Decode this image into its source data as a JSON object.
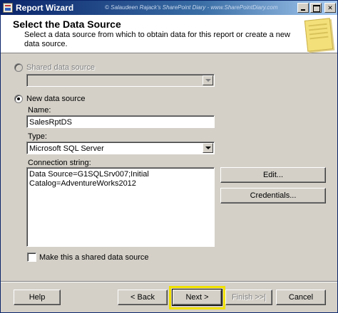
{
  "window": {
    "title": "Report Wizard",
    "watermark": "© Salaudeen Rajack's SharePoint Diary - www.SharePointDiary.com"
  },
  "header": {
    "title": "Select the Data Source",
    "subtitle": "Select a data source from which to obtain data for this report or create a new data source."
  },
  "shared_source": {
    "label": "Shared data source",
    "selected": false,
    "enabled": false,
    "dropdown_value": ""
  },
  "new_source": {
    "label": "New data source",
    "selected": true,
    "name_label": "Name:",
    "name_value": "SalesRptDS",
    "type_label": "Type:",
    "type_value": "Microsoft SQL Server",
    "connection_label": "Connection string:",
    "connection_value": "Data Source=G1SQLSrv007;Initial Catalog=AdventureWorks2012",
    "edit_label": "Edit...",
    "credentials_label": "Credentials...",
    "shared_checkbox_label": "Make this a shared data source",
    "shared_checkbox_checked": false
  },
  "footer": {
    "help": "Help",
    "back": "< Back",
    "next": "Next >",
    "finish": "Finish >>|",
    "cancel": "Cancel",
    "highlight_color": "#f0e000"
  }
}
